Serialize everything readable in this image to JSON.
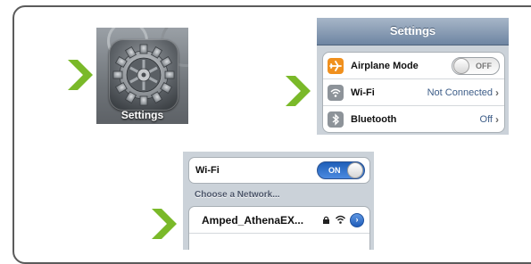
{
  "colors": {
    "accent_green": "#7ab929",
    "ios_blue": "#2f6bc6",
    "value_text": "#3d5d88"
  },
  "step1": {
    "app_label": "Settings",
    "icon": "gear-icon"
  },
  "step2": {
    "title": "Settings",
    "rows": [
      {
        "label": "Airplane Mode",
        "icon": "airplane-icon",
        "toggle": "OFF"
      },
      {
        "label": "Wi-Fi",
        "icon": "wifi-icon",
        "value": "Not Connected",
        "chevron": "›"
      },
      {
        "label": "Bluetooth",
        "icon": "bluetooth-icon",
        "value": "Off",
        "chevron": "›"
      }
    ]
  },
  "step3": {
    "wifi_label": "Wi-Fi",
    "wifi_toggle": "ON",
    "section": "Choose a Network...",
    "networks": [
      {
        "name": "Amped_AthenaEX...",
        "icons": [
          "lock-icon",
          "wifi-signal-icon",
          "info-icon"
        ]
      }
    ]
  }
}
